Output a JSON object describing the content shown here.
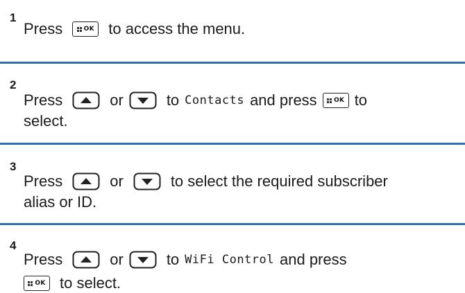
{
  "steps": [
    {
      "number": "1",
      "word_press": "Press",
      "text_after_menu": "to access the menu.",
      "icon_menu": "menu-ok-key-icon"
    },
    {
      "number": "2",
      "word_press": "Press",
      "word_or": "or",
      "word_to": "to",
      "target": "Contacts",
      "and_press": "and press",
      "to_end": "to",
      "select": "select.",
      "icons": [
        "up-arrow-key-icon",
        "down-arrow-key-icon",
        "menu-ok-key-icon"
      ]
    },
    {
      "number": "3",
      "word_press": "Press",
      "word_or": "or",
      "text_after": "to select the required subscriber",
      "line2": "alias or ID.",
      "icons": [
        "up-arrow-key-icon",
        "down-arrow-key-icon"
      ]
    },
    {
      "number": "4",
      "word_press": "Press",
      "word_or": "or",
      "word_to": "to",
      "target": "WiFi Control",
      "and_press": "and press",
      "to_select": "to select.",
      "icons": [
        "up-arrow-key-icon",
        "down-arrow-key-icon",
        "menu-ok-key-icon"
      ]
    }
  ],
  "key_ok_label": "OK",
  "divider_color": "#2f6fad"
}
